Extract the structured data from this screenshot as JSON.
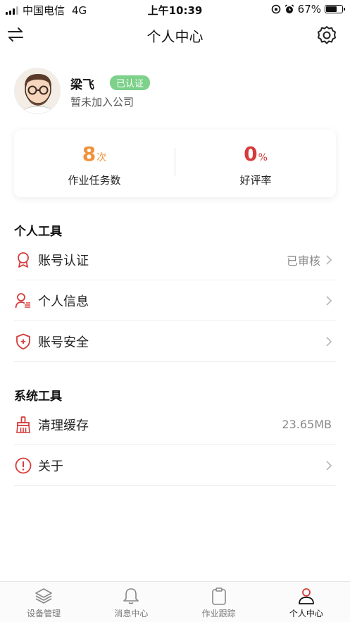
{
  "status_bar": {
    "carrier": "中国电信",
    "network": "4G",
    "time": "上午10:39",
    "battery_percent": "67%",
    "battery_level": 0.67
  },
  "nav": {
    "title": "个人中心",
    "left_icon": "swap-icon",
    "right_icon": "gear-icon"
  },
  "profile": {
    "name": "梁飞",
    "badge": "已认证",
    "company": "暂未加入公司"
  },
  "stats": [
    {
      "value": "8",
      "unit": "次",
      "label": "作业任务数",
      "color": "#f0913b"
    },
    {
      "value": "0",
      "unit": "%",
      "label": "好评率",
      "color": "#d63a3a"
    }
  ],
  "personal_tools": {
    "title": "个人工具",
    "items": [
      {
        "label": "账号认证",
        "value": "已审核",
        "icon": "award-icon"
      },
      {
        "label": "个人信息",
        "value": "",
        "icon": "user-info-icon"
      },
      {
        "label": "账号安全",
        "value": "",
        "icon": "shield-icon"
      }
    ]
  },
  "system_tools": {
    "title": "系统工具",
    "items": [
      {
        "label": "清理缓存",
        "value": "23.65MB",
        "icon": "broom-icon"
      },
      {
        "label": "关于",
        "value": "",
        "icon": "info-icon"
      }
    ]
  },
  "tabs": [
    {
      "label": "设备管理",
      "icon": "layers-icon",
      "active": false
    },
    {
      "label": "消息中心",
      "icon": "bell-icon",
      "active": false
    },
    {
      "label": "作业跟踪",
      "icon": "clipboard-icon",
      "active": false
    },
    {
      "label": "个人中心",
      "icon": "person-icon",
      "active": true
    }
  ],
  "colors": {
    "accent_red": "#d63a3a",
    "accent_orange": "#f0913b",
    "badge_green": "#7dd18a"
  }
}
